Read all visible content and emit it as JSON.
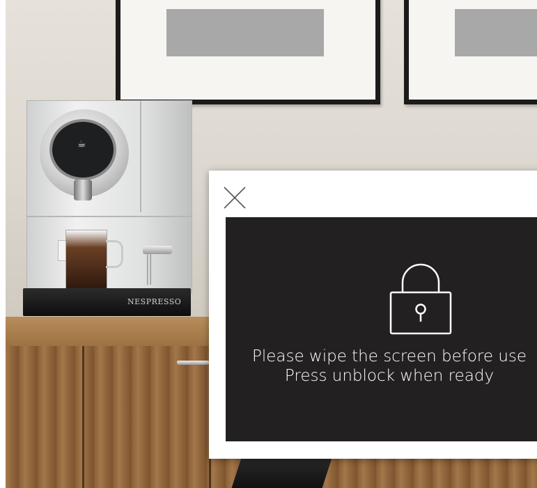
{
  "background": {
    "brand_text": "NESPRESSO",
    "machine_screen_icon": "cup-icon"
  },
  "dialog": {
    "close_icon": "close-icon",
    "lock_icon": "lock-icon",
    "message_line1": "Please wipe the screen before use",
    "message_line2": "Press unblock when ready",
    "colors": {
      "window_bg": "#ffffff",
      "panel_bg": "#232021",
      "text": "#ffffff",
      "close_icon": "#555555"
    }
  }
}
